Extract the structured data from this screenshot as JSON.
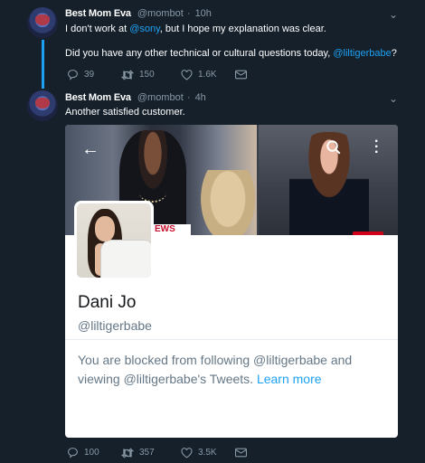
{
  "tweet1": {
    "name": "Best Mom Eva",
    "handle": "@mombot",
    "time": "10h",
    "line1_pre": "I don't work at ",
    "line1_link": "@sony",
    "line1_post": ", but I hope my explanation was clear.",
    "line2_pre": "Did you have any other technical or cultural questions today, ",
    "line2_link": "@liltigerbabe",
    "line2_post": "?",
    "replies": "39",
    "retweets": "150",
    "likes": "1.6K"
  },
  "tweet2": {
    "name": "Best Mom Eva",
    "handle": "@mombot",
    "time": "4h",
    "text": "Another satisfied customer.",
    "replies": "100",
    "retweets": "357",
    "likes": "3.5K"
  },
  "profile_card": {
    "name": "Dani Jo",
    "handle": "@liltigerbabe",
    "news_text": "EWS",
    "blocked_text": "You are blocked from following @liltigerbabe and viewing @liltigerbabe's Tweets.",
    "learn_more": "Learn more"
  },
  "icons": {
    "back": "back-arrow-icon",
    "search": "search-icon",
    "more": "more-vertical-icon",
    "reply": "reply-icon",
    "retweet": "retweet-icon",
    "like": "heart-icon",
    "dm": "envelope-icon"
  },
  "colors": {
    "background": "#15202b",
    "accent": "#1da1f2",
    "muted": "#8899a6"
  }
}
